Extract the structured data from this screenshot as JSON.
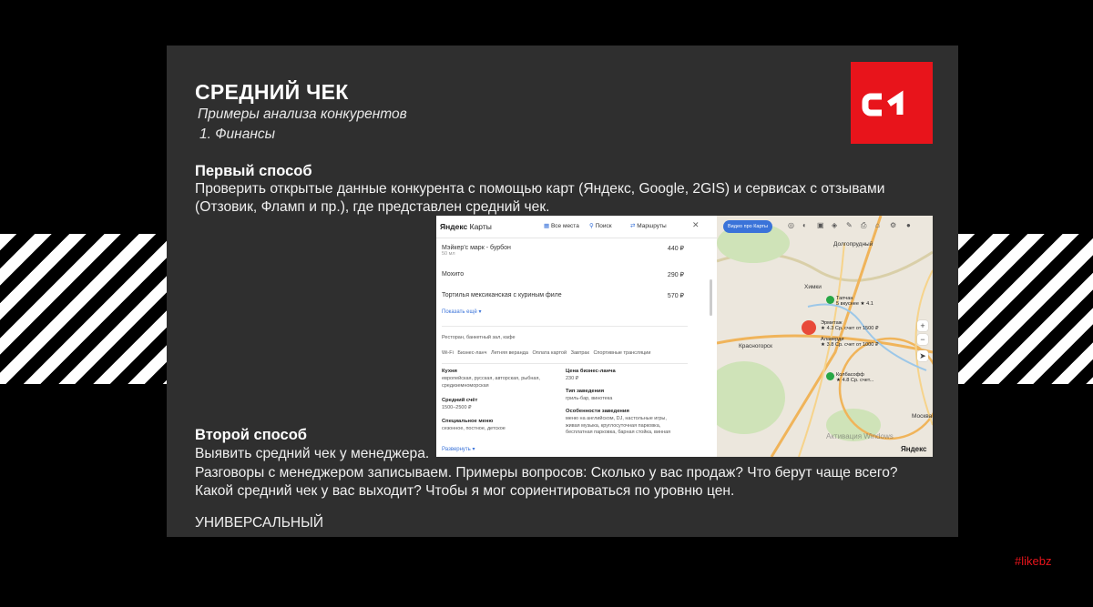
{
  "slide": {
    "title": "СРЕДНИЙ ЧЕК",
    "subtitle": "Примеры анализа конкурентов",
    "subtitle2": "1. Финансы",
    "first_heading": "Первый способ",
    "first_line1": "Проверить открытые данные конкурента с помощью карт (Яндекс, Google, 2GIS) и сервисах с отзывами",
    "first_line2": "(Отзовик, Фламп и пр.), где представлен средний чек.",
    "second_heading": "Второй способ",
    "second_line1": "Выявить средний чек у менеджера.",
    "second_line2": "Разговоры с менеджером записываем. Примеры вопросов: Сколько у вас продаж? Что берут чаще всего?",
    "second_line3": "Какой средний чек у вас выходит? Чтобы я мог сориентироваться по уровню цен.",
    "footer": "УНИВЕРСАЛЬНЫЙ",
    "hashtag": "#likebz",
    "logo_icon": "c1-logo",
    "accent_color": "#e8141b",
    "background": "#2f2f2f"
  },
  "yandex": {
    "brand_yandex": "Яндекс",
    "brand_maps": "Карты",
    "nav": [
      "Все места",
      "Поиск",
      "Маршруты"
    ],
    "items": [
      {
        "name": "Мэйкер'с марк - бурбон",
        "note": "50 мл",
        "price": "440 ₽"
      },
      {
        "name": "Мохито",
        "note": "",
        "price": "290 ₽"
      },
      {
        "name": "Тортилья мексиканская с куриным филе",
        "note": "",
        "price": "570 ₽"
      }
    ],
    "show_more": "Показать ещё ▾",
    "category": "Ресторан, банкетный зал, кафе",
    "features": "Wi-Fi   Бизнес-ланч   Летняя веранда   Оплата картой   Завтрак   Спортивные трансляции",
    "cuisine_label": "Кухня",
    "cuisine_value": "европейская, русская, авторская, рыбная, средиземноморская",
    "avg_label": "Средний счёт",
    "avg_value": "1500–2500 ₽",
    "special_label": "Специальное меню",
    "special_value": "сезонное, постное, детское",
    "biz_label": "Цена бизнес-ланча",
    "biz_value": "230 ₽",
    "type_label": "Тип заведения",
    "type_value": "гриль-бар, винотека",
    "features_label": "Особенности заведения",
    "features_value": "меню на английском, DJ, настольные игры, живая музыка, круглосуточная парковка, бесплатная парковка, барная стойка, винная",
    "expand": "Развернуть ▾"
  },
  "map": {
    "video_button": "Видео про Карты",
    "places": {
      "dolgoprudny": "Долгопрудный",
      "khimki": "Химки",
      "krasnogorsk": "Красногорск",
      "moskva": "Москва"
    },
    "pins": {
      "tapan": "Тапчан",
      "tapan_sub": "5 вкуснее ★ 4.1",
      "ermitazh": "Эрмитаж",
      "ermitazh_sub": "★ 4.3 Ср. счет от 1500 ₽",
      "alaverdi": "Алаверди",
      "alaverdi_sub": "★ 3.8 Ср. счет от 1000 ₽",
      "kolbasoff": "Колбасофф",
      "kolbasoff_sub": "★ 4.8 Ср. счет..."
    },
    "watermark": "Активация Windows",
    "logo": "Яндекс"
  }
}
